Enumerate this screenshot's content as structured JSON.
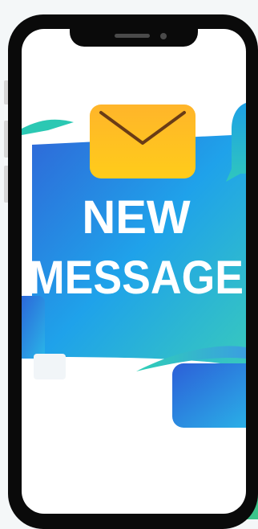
{
  "image": {
    "headline_line1": "NEW",
    "headline_line2": "MESSAGE",
    "icon": "envelope-icon"
  },
  "colors": {
    "phone": "#0a0a0a",
    "screen": "#ffffff",
    "banner_blue": "#2b77e0",
    "banner_teal": "#2bc9c9",
    "envelope": "#ffbb1e",
    "headline": "#ffffff"
  }
}
